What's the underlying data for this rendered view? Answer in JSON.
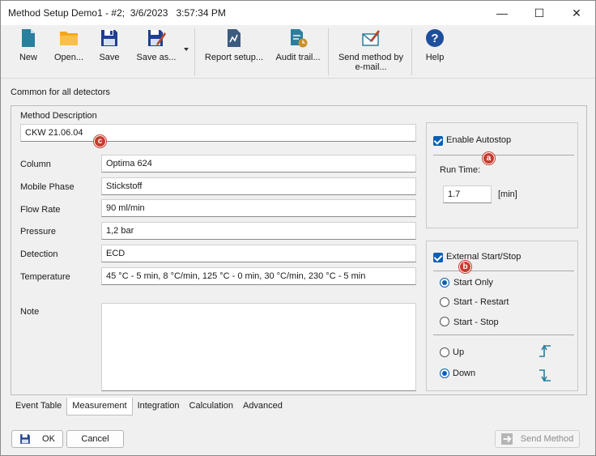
{
  "window": {
    "title": "Method Setup Demo1 - #2;  3/6/2023   3:57:34 PM",
    "controls": {
      "minimize_glyph": "—",
      "maximize_glyph": "☐",
      "close_glyph": "✕"
    }
  },
  "toolbar": {
    "new_label": "New",
    "open_label": "Open...",
    "save_label": "Save",
    "save_as_label": "Save as...",
    "report_setup_label": "Report setup...",
    "audit_trail_label": "Audit trail...",
    "send_email_label_line1": "Send method by",
    "send_email_label_line2": "e-mail...",
    "help_label": "Help"
  },
  "section_title": "Common for all detectors",
  "method": {
    "description_label": "Method Description",
    "description_value": "CKW 21.06.04",
    "fields": [
      {
        "label": "Column",
        "value": "Optima 624"
      },
      {
        "label": "Mobile Phase",
        "value": "Stickstoff"
      },
      {
        "label": "Flow Rate",
        "value": "90 ml/min"
      },
      {
        "label": "Pressure",
        "value": "1,2 bar"
      },
      {
        "label": "Detection",
        "value": "ECD"
      },
      {
        "label": "Temperature",
        "value": "45 °C - 5 min, 8 °C/min, 125 °C - 0 min, 30 °C/min, 230 °C - 5 min"
      }
    ],
    "note_label": "Note",
    "note_value": ""
  },
  "autostop": {
    "enable_label": "Enable Autostop",
    "enabled": true,
    "run_time_label": "Run Time:",
    "run_time_value": "1.7",
    "unit_label": "[min]"
  },
  "external": {
    "label": "External Start/Stop",
    "enabled": true,
    "modes": [
      "Start Only",
      "Start - Restart",
      "Start - Stop"
    ],
    "selected_mode": "Start Only",
    "edge_up_label": "Up",
    "edge_down_label": "Down",
    "selected_edge": "Down"
  },
  "markers": {
    "a": "a",
    "b": "b",
    "c": "c"
  },
  "tabs": [
    "Event Table",
    "Measurement",
    "Integration",
    "Calculation",
    "Advanced"
  ],
  "active_tab": "Measurement",
  "footer": {
    "ok_label": "OK",
    "cancel_label": "Cancel",
    "send_method_label": "Send Method"
  },
  "colors": {
    "accent": "#0a5fb4",
    "marker": "#c63b2e",
    "folder": "#f2a81d",
    "teal_icon": "#2a7f9e",
    "help": "#1f4e9c"
  },
  "icons": [
    "new-document-icon",
    "open-folder-icon",
    "save-icon",
    "save-as-icon",
    "report-setup-icon",
    "audit-trail-icon",
    "send-email-icon",
    "help-icon",
    "edge-up-icon",
    "edge-down-icon",
    "send-icon"
  ]
}
